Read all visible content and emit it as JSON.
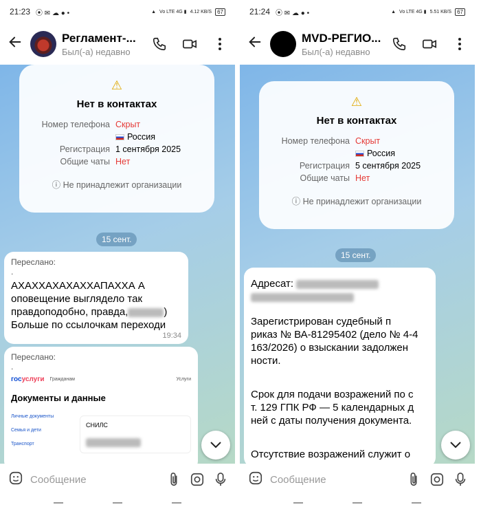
{
  "left": {
    "status": {
      "time": "21:23",
      "speed": "4.12 KB/S",
      "battery": "67"
    },
    "header": {
      "name": "Регламент-...",
      "status": "Был(-а) недавно"
    },
    "info": {
      "title": "Нет в контактах",
      "phone_label": "Номер телефона",
      "phone_value": "Скрыт",
      "country": "Россия",
      "reg_label": "Регистрация",
      "reg_value": "1 сентября 2025",
      "chats_label": "Общие чаты",
      "chats_value": "Нет",
      "org": "Не принадлежит организации"
    },
    "date": "15 сент.",
    "msg1": {
      "fwd": "Переслано:",
      "dot": ".",
      "line1": "АХАХХАХАХАХХАПАХХА А",
      "line2": "оповещение выглядело так",
      "line3a": "правдоподобно, правда,",
      "line3b": ")",
      "line4": "Больше по ссылочкам переходи",
      "time": "19:34"
    },
    "msg2": {
      "fwd": "Переслано:",
      "dot": ".",
      "logo_a": "гос",
      "logo_b": "услуги",
      "citizens": "Гражданам",
      "services": "Услуги",
      "doc_title": "Документы и данные",
      "side_items": [
        "Личные документы",
        "Семья и дети",
        "Транспорт"
      ],
      "snils": "СНИЛС"
    }
  },
  "right": {
    "status": {
      "time": "21:24",
      "speed": "5.51 KB/S",
      "battery": "67"
    },
    "header": {
      "name": "MVD-РЕГИО...",
      "status": "Был(-а) недавно"
    },
    "info": {
      "title": "Нет в контактах",
      "phone_label": "Номер телефона",
      "phone_value": "Скрыт",
      "country": "Россия",
      "reg_label": "Регистрация",
      "reg_value": "5 сентября 2025",
      "chats_label": "Общие чаты",
      "chats_value": "Нет",
      "org": "Не принадлежит организации"
    },
    "date": "15 сент.",
    "msg": {
      "addressee": "Адресат:",
      "p1": [
        "Зарегистрирован судебный п",
        "риказ № ВА-81295402 (дело № 4-4",
        "163/2026) о взыскании задолжен",
        "ности."
      ],
      "p2": [
        "Срок для подачи возражений по с",
        "т. 129 ГПК РФ — 5 календарных д",
        "ней с даты получения документа."
      ],
      "p3": [
        "Отсутствие возражений служит о"
      ]
    }
  },
  "composer": {
    "placeholder": "Сообщение"
  },
  "colors": {
    "accent_red": "#e53935",
    "warning": "#e0a800",
    "chat_bg": "#7fb6e8"
  },
  "icons": [
    "back-arrow-icon",
    "phone-icon",
    "video-icon",
    "more-icon",
    "warning-icon",
    "info-icon",
    "chevron-down-icon",
    "sticker-icon",
    "attach-icon",
    "camera-icon",
    "mic-icon"
  ]
}
